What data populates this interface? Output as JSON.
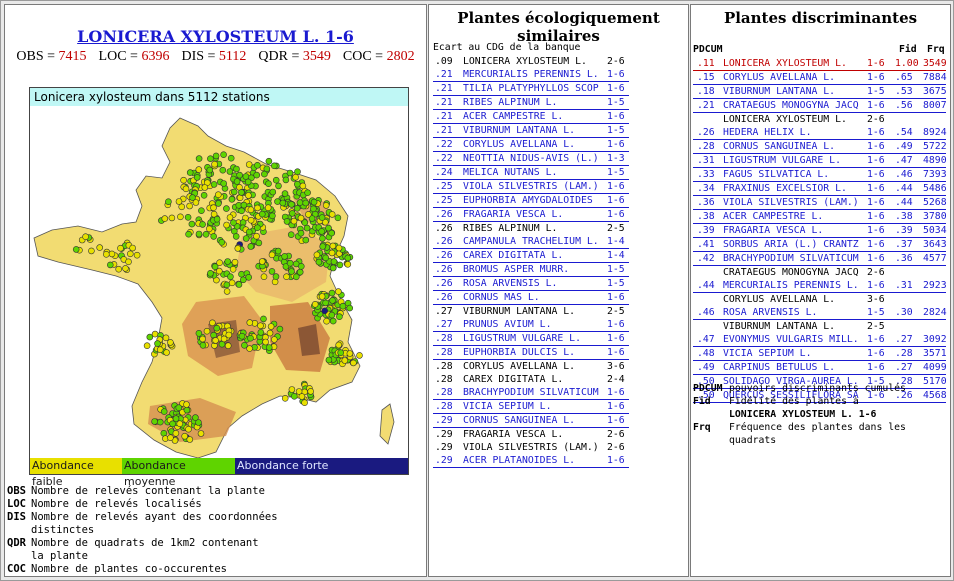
{
  "species": {
    "title": "LONICERA XYLOSTEUM L. 1-6",
    "stats": [
      {
        "key": "OBS",
        "value": "7415"
      },
      {
        "key": "LOC",
        "value": "6396"
      },
      {
        "key": "DIS",
        "value": "5112"
      },
      {
        "key": "QDR",
        "value": "3549"
      },
      {
        "key": "COC",
        "value": "2802"
      }
    ]
  },
  "map": {
    "caption": "Lonicera xylosteum dans 5112 stations",
    "legend": [
      {
        "label": "Abondance faible",
        "color": "#e8e000"
      },
      {
        "label": "Abondance moyenne",
        "color": "#5fd400"
      },
      {
        "label": "Abondance forte",
        "color": "#1a1a80"
      }
    ]
  },
  "definitions": [
    {
      "key": "OBS",
      "text": "Nombre de relevés contenant la plante"
    },
    {
      "key": "LOC",
      "text": "Nombre de relevés localisés"
    },
    {
      "key": "DIS",
      "text": "Nombre de relevés ayant des coordonnées"
    },
    {
      "key": "",
      "text": "distinctes"
    },
    {
      "key": "QDR",
      "text": "Nombre de quadrats de 1km2 contenant"
    },
    {
      "key": "",
      "text": "la plante"
    },
    {
      "key": "COC",
      "text": "Nombre de plantes co-occurentes"
    }
  ],
  "similar": {
    "heading": "Plantes écologiquement similaires",
    "subheading": "Ecart au CDG de la banque",
    "rows": [
      {
        "ecart": ".09",
        "name": "LONICERA XYLOSTEUM L.",
        "range": "2-6",
        "link": false
      },
      {
        "ecart": ".21",
        "name": "MERCURIALIS PERENNIS L.",
        "range": "1-6",
        "link": true
      },
      {
        "ecart": ".21",
        "name": "TILIA PLATYPHYLLOS SCOP",
        "range": "1-6",
        "link": true
      },
      {
        "ecart": ".21",
        "name": "RIBES ALPINUM L.",
        "range": "1-5",
        "link": true
      },
      {
        "ecart": ".21",
        "name": "ACER CAMPESTRE L.",
        "range": "1-6",
        "link": true
      },
      {
        "ecart": ".21",
        "name": "VIBURNUM LANTANA L.",
        "range": "1-5",
        "link": true
      },
      {
        "ecart": ".22",
        "name": "CORYLUS AVELLANA L.",
        "range": "1-6",
        "link": true
      },
      {
        "ecart": ".22",
        "name": "NEOTTIA NIDUS-AVIS (L.)",
        "range": "1-3",
        "link": true
      },
      {
        "ecart": ".24",
        "name": "MELICA NUTANS L.",
        "range": "1-5",
        "link": true
      },
      {
        "ecart": ".25",
        "name": "VIOLA SILVESTRIS (LAM.)",
        "range": "1-6",
        "link": true
      },
      {
        "ecart": ".25",
        "name": "EUPHORBIA AMYGDALOIDES",
        "range": "1-6",
        "link": true
      },
      {
        "ecart": ".26",
        "name": "FRAGARIA VESCA L.",
        "range": "1-6",
        "link": true
      },
      {
        "ecart": ".26",
        "name": "RIBES ALPINUM L.",
        "range": "2-5",
        "link": false
      },
      {
        "ecart": ".26",
        "name": "CAMPANULA TRACHELIUM L.",
        "range": "1-4",
        "link": true
      },
      {
        "ecart": ".26",
        "name": "CAREX DIGITATA L.",
        "range": "1-4",
        "link": true
      },
      {
        "ecart": ".26",
        "name": "BROMUS ASPER MURR.",
        "range": "1-5",
        "link": true
      },
      {
        "ecart": ".26",
        "name": "ROSA ARVENSIS L.",
        "range": "1-5",
        "link": true
      },
      {
        "ecart": ".26",
        "name": "CORNUS MAS L.",
        "range": "1-6",
        "link": true
      },
      {
        "ecart": ".27",
        "name": "VIBURNUM LANTANA L.",
        "range": "2-5",
        "link": false
      },
      {
        "ecart": ".27",
        "name": "PRUNUS AVIUM L.",
        "range": "1-6",
        "link": true
      },
      {
        "ecart": ".28",
        "name": "LIGUSTRUM VULGARE L.",
        "range": "1-6",
        "link": true
      },
      {
        "ecart": ".28",
        "name": "EUPHORBIA DULCIS L.",
        "range": "1-6",
        "link": true
      },
      {
        "ecart": ".28",
        "name": "CORYLUS AVELLANA L.",
        "range": "3-6",
        "link": false
      },
      {
        "ecart": ".28",
        "name": "CAREX DIGITATA L.",
        "range": "2-4",
        "link": false
      },
      {
        "ecart": ".28",
        "name": "BRACHYPODIUM SILVATICUM",
        "range": "1-6",
        "link": true
      },
      {
        "ecart": ".28",
        "name": "VICIA SEPIUM L.",
        "range": "1-6",
        "link": true
      },
      {
        "ecart": ".29",
        "name": "CORNUS SANGUINEA L.",
        "range": "1-6",
        "link": true
      },
      {
        "ecart": ".29",
        "name": "FRAGARIA VESCA L.",
        "range": "2-6",
        "link": false
      },
      {
        "ecart": ".29",
        "name": "VIOLA SILVESTRIS (LAM.)",
        "range": "2-6",
        "link": false
      },
      {
        "ecart": ".29",
        "name": "ACER PLATANOIDES L.",
        "range": "1-6",
        "link": true
      }
    ]
  },
  "discriminant": {
    "heading": "Plantes discriminantes",
    "col_pdcum": "PDCUM",
    "col_fid": "Fid",
    "col_frq": "Frq",
    "rows": [
      {
        "pdcum": ".11",
        "name": "LONICERA XYLOSTEUM L.",
        "range": "1-6",
        "fid": "1.00",
        "frq": "3549",
        "link": true,
        "highlight": true
      },
      {
        "pdcum": ".15",
        "name": "CORYLUS AVELLANA L.",
        "range": "1-6",
        "fid": ".65",
        "frq": "7884",
        "link": true
      },
      {
        "pdcum": ".18",
        "name": "VIBURNUM LANTANA L.",
        "range": "1-5",
        "fid": ".53",
        "frq": "3675",
        "link": true
      },
      {
        "pdcum": ".21",
        "name": "CRATAEGUS MONOGYNA JACQ",
        "range": "1-6",
        "fid": ".56",
        "frq": "8007",
        "link": true
      },
      {
        "pdcum": "",
        "name": "LONICERA XYLOSTEUM L.",
        "range": "2-6",
        "fid": "",
        "frq": "",
        "link": false
      },
      {
        "pdcum": ".26",
        "name": "HEDERA HELIX L.",
        "range": "1-6",
        "fid": ".54",
        "frq": "8924",
        "link": true
      },
      {
        "pdcum": ".28",
        "name": "CORNUS SANGUINEA L.",
        "range": "1-6",
        "fid": ".49",
        "frq": "5722",
        "link": true
      },
      {
        "pdcum": ".31",
        "name": "LIGUSTRUM VULGARE L.",
        "range": "1-6",
        "fid": ".47",
        "frq": "4890",
        "link": true
      },
      {
        "pdcum": ".33",
        "name": "FAGUS SILVATICA L.",
        "range": "1-6",
        "fid": ".46",
        "frq": "7393",
        "link": true
      },
      {
        "pdcum": ".34",
        "name": "FRAXINUS EXCELSIOR L.",
        "range": "1-6",
        "fid": ".44",
        "frq": "5486",
        "link": true
      },
      {
        "pdcum": ".36",
        "name": "VIOLA SILVESTRIS (LAM.)",
        "range": "1-6",
        "fid": ".44",
        "frq": "5268",
        "link": true
      },
      {
        "pdcum": ".38",
        "name": "ACER CAMPESTRE L.",
        "range": "1-6",
        "fid": ".38",
        "frq": "3780",
        "link": true
      },
      {
        "pdcum": ".39",
        "name": "FRAGARIA VESCA L.",
        "range": "1-6",
        "fid": ".39",
        "frq": "5034",
        "link": true
      },
      {
        "pdcum": ".41",
        "name": "SORBUS ARIA (L.) CRANTZ",
        "range": "1-6",
        "fid": ".37",
        "frq": "3643",
        "link": true
      },
      {
        "pdcum": ".42",
        "name": "BRACHYPODIUM SILVATICUM",
        "range": "1-6",
        "fid": ".36",
        "frq": "4577",
        "link": true
      },
      {
        "pdcum": "",
        "name": "CRATAEGUS MONOGYNA JACQ",
        "range": "2-6",
        "fid": "",
        "frq": "",
        "link": false
      },
      {
        "pdcum": ".44",
        "name": "MERCURIALIS PERENNIS L.",
        "range": "1-6",
        "fid": ".31",
        "frq": "2923",
        "link": true
      },
      {
        "pdcum": "",
        "name": "CORYLUS AVELLANA L.",
        "range": "3-6",
        "fid": "",
        "frq": "",
        "link": false
      },
      {
        "pdcum": ".46",
        "name": "ROSA ARVENSIS L.",
        "range": "1-5",
        "fid": ".30",
        "frq": "2824",
        "link": true
      },
      {
        "pdcum": "",
        "name": "VIBURNUM LANTANA L.",
        "range": "2-5",
        "fid": "",
        "frq": "",
        "link": false
      },
      {
        "pdcum": ".47",
        "name": "EVONYMUS VULGARIS MILL.",
        "range": "1-6",
        "fid": ".27",
        "frq": "3092",
        "link": true
      },
      {
        "pdcum": ".48",
        "name": "VICIA SEPIUM L.",
        "range": "1-6",
        "fid": ".28",
        "frq": "3571",
        "link": true
      },
      {
        "pdcum": ".49",
        "name": "CARPINUS BETULUS L.",
        "range": "1-6",
        "fid": ".27",
        "frq": "4099",
        "link": true
      },
      {
        "pdcum": ".50",
        "name": "SOLIDAGO VIRGA-AUREA L.",
        "range": "1-5",
        "fid": ".28",
        "frq": "5170",
        "link": true
      },
      {
        "pdcum": ".50",
        "name": "QUERCUS SESSILIFLORA SA",
        "range": "1-6",
        "fid": ".26",
        "frq": "4568",
        "link": true
      }
    ],
    "notes": [
      {
        "key": "PDCUM",
        "text": "pouvoirs discriminants cumulés"
      },
      {
        "key": "Fid",
        "text": "Fidélité des plantes à"
      },
      {
        "key": "",
        "text": "LONICERA XYLOSTEUM L.   1-6",
        "bold": true
      },
      {
        "key": "Frq",
        "text": "Fréquence des plantes dans les"
      },
      {
        "key": "",
        "text": "quadrats"
      }
    ]
  }
}
